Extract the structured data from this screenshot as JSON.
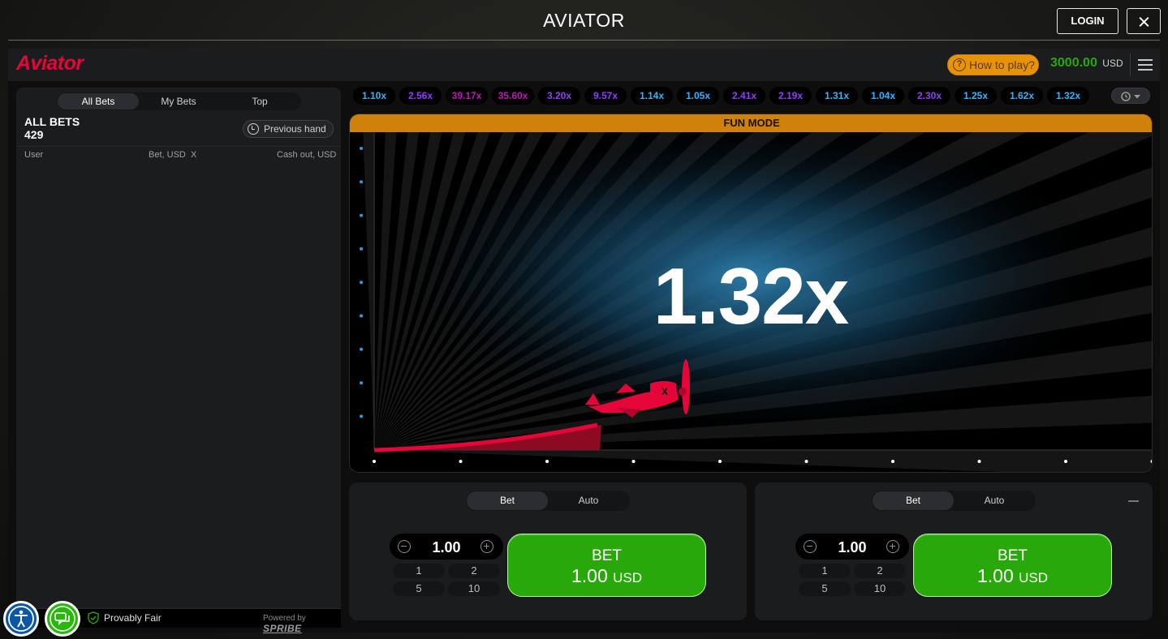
{
  "topbar": {
    "title": "AVIATOR",
    "login_label": "LOGIN"
  },
  "header": {
    "logo": "Aviator",
    "how_to_play": "How to play?",
    "balance": "3000.00",
    "currency": "USD"
  },
  "left_panel": {
    "tabs": [
      "All Bets",
      "My Bets",
      "Top"
    ],
    "active_tab": "All Bets",
    "all_bets_label": "ALL BETS",
    "all_bets_count": "429",
    "previous_hand_label": "Previous hand",
    "columns": {
      "user": "User",
      "bet": "Bet, USD",
      "x": "X",
      "cashout": "Cash out, USD"
    },
    "footer": {
      "provably_fair": "Provably Fair",
      "powered_by": "Powered by",
      "brand": "SPRIBE"
    }
  },
  "history": [
    {
      "value": "1.10x",
      "color": "#34b4ff"
    },
    {
      "value": "2.56x",
      "color": "#913ef8"
    },
    {
      "value": "39.17x",
      "color": "#c017b4"
    },
    {
      "value": "35.60x",
      "color": "#c017b4"
    },
    {
      "value": "3.20x",
      "color": "#913ef8"
    },
    {
      "value": "9.57x",
      "color": "#913ef8"
    },
    {
      "value": "1.14x",
      "color": "#34b4ff"
    },
    {
      "value": "1.05x",
      "color": "#34b4ff"
    },
    {
      "value": "2.41x",
      "color": "#913ef8"
    },
    {
      "value": "2.19x",
      "color": "#913ef8"
    },
    {
      "value": "1.31x",
      "color": "#34b4ff"
    },
    {
      "value": "1.04x",
      "color": "#34b4ff"
    },
    {
      "value": "2.30x",
      "color": "#913ef8"
    },
    {
      "value": "1.25x",
      "color": "#34b4ff"
    },
    {
      "value": "1.62x",
      "color": "#34b4ff"
    },
    {
      "value": "1.32x",
      "color": "#34b4ff"
    }
  ],
  "stage": {
    "mode_label": "FUN MODE",
    "multiplier": "1.32x"
  },
  "bet_panels": [
    {
      "tabs": [
        "Bet",
        "Auto"
      ],
      "active_tab": "Bet",
      "amount": "1.00",
      "quick": [
        "1",
        "2",
        "5",
        "10"
      ],
      "button_title": "BET",
      "button_amount": "1.00",
      "button_currency": "USD"
    },
    {
      "tabs": [
        "Bet",
        "Auto"
      ],
      "active_tab": "Bet",
      "amount": "1.00",
      "quick": [
        "1",
        "2",
        "5",
        "10"
      ],
      "button_title": "BET",
      "button_amount": "1.00",
      "button_currency": "USD"
    }
  ],
  "colors": {
    "accent_red": "#e50539",
    "green": "#28a909",
    "orange": "#d08109"
  }
}
